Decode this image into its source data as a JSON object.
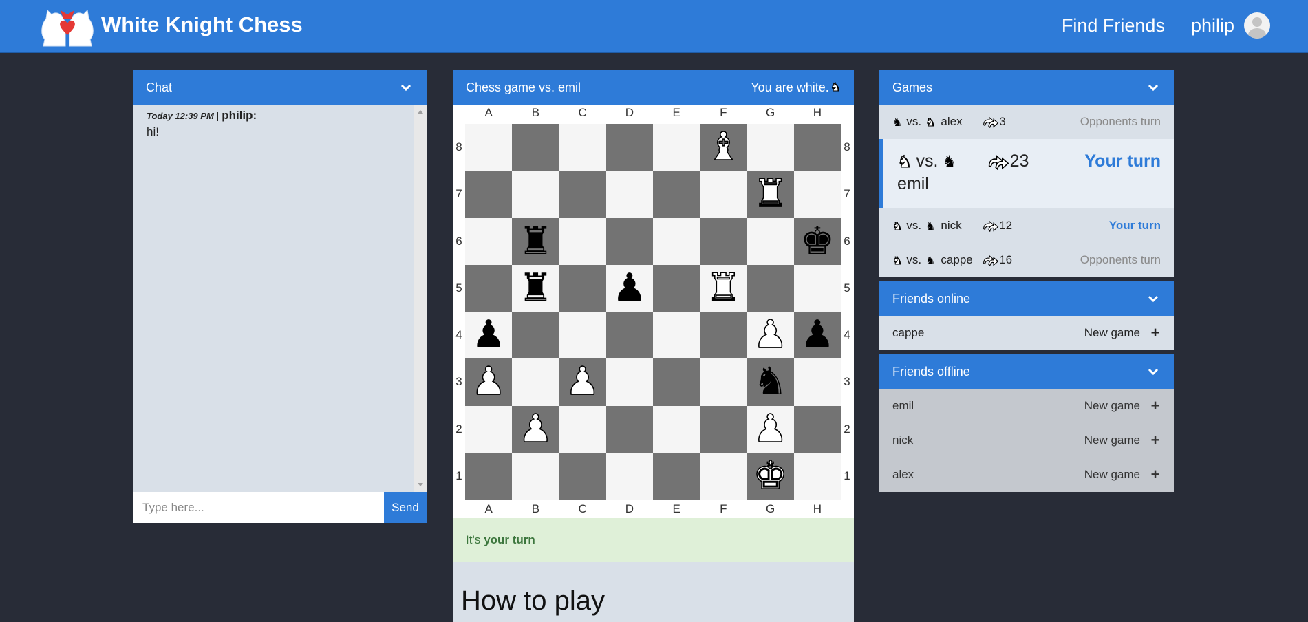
{
  "header": {
    "brand": "White Knight Chess",
    "find_friends": "Find Friends",
    "username": "philip",
    "logo_icon": "two-knights-logo-icon",
    "accent": "#2e7bd8"
  },
  "chat": {
    "title": "Chat",
    "messages": [
      {
        "time": "Today 12:39 PM",
        "sep": "|",
        "author": "philip:",
        "text": "hi!"
      }
    ],
    "placeholder": "Type here...",
    "send_label": "Send"
  },
  "game": {
    "title": "Chess game vs. emil",
    "color_note": "You are white.",
    "files": [
      "A",
      "B",
      "C",
      "D",
      "E",
      "F",
      "G",
      "H"
    ],
    "ranks": [
      "8",
      "7",
      "6",
      "5",
      "4",
      "3",
      "2",
      "1"
    ],
    "board": [
      [
        "",
        "",
        "",
        "",
        "",
        "wB",
        "",
        ""
      ],
      [
        "",
        "",
        "",
        "",
        "",
        "",
        "wR",
        ""
      ],
      [
        "",
        "bR",
        "",
        "",
        "",
        "",
        "",
        "bK"
      ],
      [
        "",
        "bR",
        "",
        "bP",
        "",
        "wR",
        "",
        ""
      ],
      [
        "bP",
        "",
        "",
        "",
        "",
        "",
        "wP",
        "bP"
      ],
      [
        "wP",
        "",
        "wP",
        "",
        "",
        "",
        "bN",
        ""
      ],
      [
        "",
        "wP",
        "",
        "",
        "",
        "",
        "wP",
        ""
      ],
      [
        "",
        "",
        "",
        "",
        "",
        "",
        "wK",
        ""
      ]
    ],
    "turn_prefix": "It's",
    "turn_bold": "your turn",
    "howto_title": "How to play"
  },
  "games": {
    "title": "Games",
    "items": [
      {
        "vs": "vs.",
        "opponent": "alex",
        "moves": "3",
        "status": "Opponents turn",
        "mine": false,
        "me": "b",
        "them": "w",
        "active": false
      },
      {
        "vs": "vs.",
        "opponent": "emil",
        "moves": "23",
        "status": "Your turn",
        "mine": true,
        "me": "w",
        "them": "b",
        "active": true
      },
      {
        "vs": "vs.",
        "opponent": "nick",
        "moves": "12",
        "status": "Your turn",
        "mine": true,
        "me": "w",
        "them": "b",
        "active": false
      },
      {
        "vs": "vs.",
        "opponent": "cappe",
        "moves": "16",
        "status": "Opponents turn",
        "mine": false,
        "me": "w",
        "them": "b",
        "active": false
      }
    ]
  },
  "friends_online": {
    "title": "Friends online",
    "items": [
      {
        "name": "cappe",
        "action": "New game"
      }
    ]
  },
  "friends_offline": {
    "title": "Friends offline",
    "items": [
      {
        "name": "emil",
        "action": "New game"
      },
      {
        "name": "nick",
        "action": "New game"
      },
      {
        "name": "alex",
        "action": "New game"
      }
    ]
  },
  "icons": {
    "chevron": "chevron-down-icon",
    "moves": "moves-arrows-icon",
    "plus": "plus-icon",
    "avatar": "user-avatar-icon"
  }
}
